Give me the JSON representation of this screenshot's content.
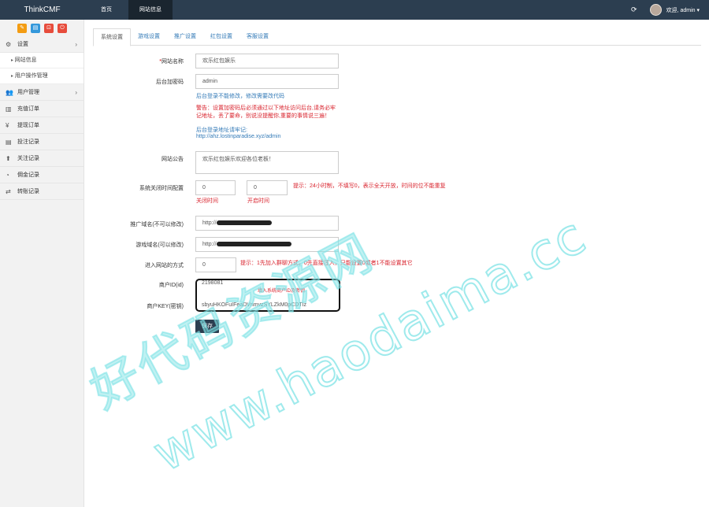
{
  "topbar": {
    "brand": "ThinkCMF",
    "nav": [
      "首页",
      "网站信息"
    ],
    "user": "欢迎, admin"
  },
  "sidebar": {
    "items": [
      {
        "label": "设置",
        "icon": "gears-icon"
      },
      {
        "label": "网站信息",
        "sub": true
      },
      {
        "label": "用户操作管理",
        "sub": true
      },
      {
        "label": "用户管理",
        "icon": "users-icon"
      },
      {
        "label": "充值订单",
        "icon": "chart-icon"
      },
      {
        "label": "提现订单",
        "icon": "yen-icon"
      },
      {
        "label": "投注记录",
        "icon": "list-icon"
      },
      {
        "label": "关注记录",
        "icon": "user-icon"
      },
      {
        "label": "佣金记录",
        "icon": "pie-icon"
      },
      {
        "label": "转账记录",
        "icon": "exchange-icon"
      }
    ],
    "quick_colors": [
      "#f39c12",
      "#3498db",
      "#e74c3c",
      "#e74c3c"
    ]
  },
  "tabs": [
    "系统设置",
    "游戏设置",
    "推广设置",
    "红包设置",
    "客服设置"
  ],
  "form": {
    "site_name": {
      "label": "网站名称",
      "value": "欢乐红包娱乐"
    },
    "admin_password": {
      "label": "后台加密码",
      "value": "admin",
      "help": "后台登录不能修改，修改需要改代码",
      "warn": "警告：设置加密码后必须通过以下地址访问后台,请务必牢记地址，丢了要命，别说没提醒你,重要的事情说三遍！",
      "addr_label": "后台登录地址请牢记:",
      "addr_url": "http://ahz.lostinparadise.xyz/admin"
    },
    "notice": {
      "label": "网站公告",
      "value": "欢乐红包娱乐欢迎各位老板！"
    },
    "close_time": {
      "label": "系统关闭时间配置",
      "close_value": "0",
      "open_value": "0",
      "hint": "提示：24小时制，不填写0，表示全天开放，时间的位不能重复",
      "close_label": "关闭时间",
      "open_label": "开启时间"
    },
    "promo_domain": {
      "label": "推广域名(不可以修改)",
      "value": "http://"
    },
    "game_domain": {
      "label": "游戏域名(可以修改)",
      "value": "http://"
    },
    "entry_mode": {
      "label": "进入网站的方式",
      "value": "0",
      "hint": "提示：1先加入群聊方式，0先直接注入，只能设置0或者1不能设置其它"
    },
    "merchant_id": {
      "label": "商户ID(id)",
      "value": "2198081"
    },
    "merchant_key": {
      "label": "商户KEY(密钥)",
      "value": "sbyuHKOFuIFeaDVnmvzSYLZkM0pCDTIz",
      "overlay": "填入系统商户ID及密钥"
    },
    "save": "保存"
  },
  "watermark": {
    "cn": "好代码资源网",
    "en": "www.haodaima.cc",
    "color": "#7fe3e6"
  }
}
